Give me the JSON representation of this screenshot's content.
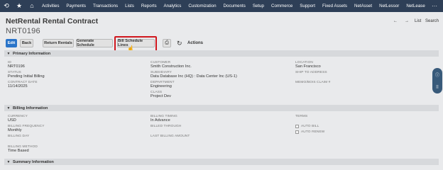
{
  "nav": {
    "items": [
      "Activities",
      "Payments",
      "Transactions",
      "Lists",
      "Reports",
      "Analytics",
      "Customization",
      "Documents",
      "Setup",
      "Commerce",
      "Support",
      "Fixed Assets",
      "NetAsset",
      "NetLessor",
      "NetLease"
    ],
    "more": "···"
  },
  "page": {
    "title": "NetRental Rental Contract",
    "record_id": "NRT0196",
    "list_label": "List",
    "search_label": "Search"
  },
  "buttons": {
    "edit": "Edit",
    "back": "Back",
    "return_rentals": "Return Rentals",
    "generate_schedule": "Generate Schedule",
    "bill_schedule_lines": "Bill Schedule Lines",
    "actions": "Actions"
  },
  "primary": {
    "header": "Primary Information",
    "id_label": "ID",
    "id_value": "NRT0196",
    "status_label": "STATUS",
    "status_value": "Pending Initial Billing",
    "contract_date_label": "CONTRACT DATE",
    "contract_date_value": "11/14/2025",
    "customer_label": "CUSTOMER",
    "customer_value": "Smith Construction Inc.",
    "subsidiary_label": "SUBSIDIARY",
    "subsidiary_value": "Data Database Inc (HQ) : Data Center Inc (US-1)",
    "department_label": "DEPARTMENT",
    "department_value": "Engineering",
    "class_label": "CLASS",
    "class_value": "Project Dev",
    "location_label": "LOCATION",
    "location_value": "San Francisco",
    "ship_to_label": "SHIP TO ADDRESS",
    "memo_label": "MEMO/BOIS CLAIM #"
  },
  "billing": {
    "header": "Billing Information",
    "currency_label": "CURRENCY",
    "currency_value": "USD",
    "frequency_label": "BILLING FREQUENCY",
    "frequency_value": "Monthly",
    "billing_day_label": "BILLING DAY",
    "method_label": "BILLING METHOD",
    "method_value": "Time Based",
    "timing_label": "BILLING TIMING",
    "timing_value": "In Advance",
    "billed_through_label": "BILLED THROUGH",
    "last_amount_label": "LAST BILLING AMOUNT",
    "terms_label": "TERMS",
    "auto_bill_label": "AUTO BILL",
    "auto_renew_label": "AUTO RENEW"
  },
  "summary": {
    "header": "Summary Information"
  }
}
